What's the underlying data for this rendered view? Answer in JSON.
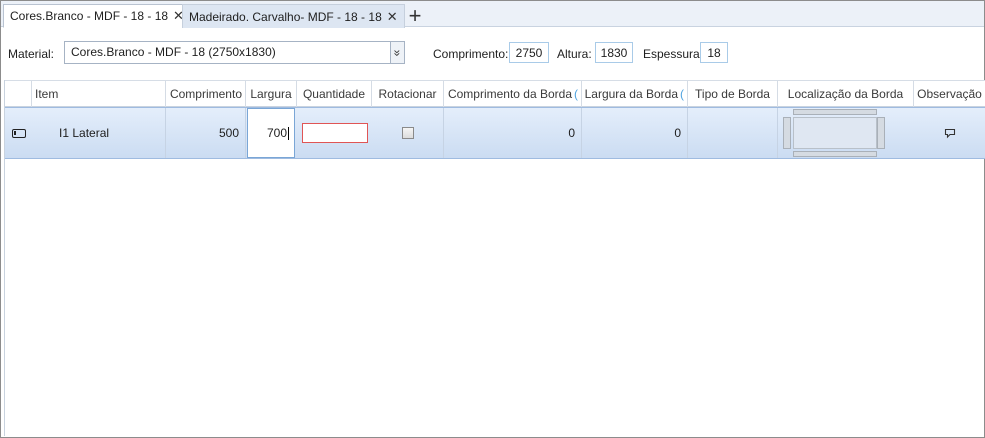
{
  "tabs": [
    {
      "label": "Cores.Branco - MDF - 18 - 18",
      "close": "✕"
    },
    {
      "label": "Madeirado. Carvalho- MDF - 18 - 18",
      "close": "✕"
    }
  ],
  "add_tab": "+",
  "material": {
    "label": "Material:",
    "value": "Cores.Branco - MDF - 18 (2750x1830)",
    "dropdown_glyph": "»"
  },
  "dimensions": {
    "comprimento_label": "Comprimento:",
    "comprimento_value": "2750",
    "altura_label": "Altura:",
    "altura_value": "1830",
    "espessura_label": "Espessura:",
    "espessura_value": "18"
  },
  "grid": {
    "columns": {
      "item": "Item",
      "comprimento": "Comprimento",
      "largura": "Largura",
      "quantidade": "Quantidade",
      "rotacionar": "Rotacionar",
      "comprimento_borda": "Comprimento da Borda",
      "largura_borda": "Largura da Borda",
      "tipo_borda": "Tipo de Borda",
      "localizacao_borda": "Localização da Borda",
      "observacao": "Observação"
    },
    "paren_glyph": "(",
    "rows": [
      {
        "item": "I1  Lateral",
        "comprimento": "500",
        "largura": "700",
        "quantidade": "",
        "rotacionar": false,
        "comprimento_borda": "0",
        "largura_borda": "0",
        "tipo_borda": "",
        "observacao_icon": "comment-icon"
      }
    ]
  },
  "colors": {
    "selected_row": "#cbdcf2",
    "invalid_border": "#e05555",
    "accent": "#4fa3e0"
  }
}
